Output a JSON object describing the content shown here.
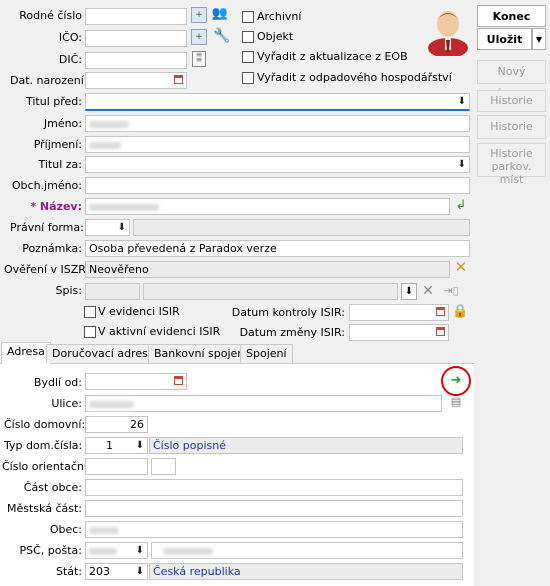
{
  "buttons": {
    "konec": "Konec",
    "ulozit": "Uložit",
    "ulozit_arrow": "▼",
    "novy_zaznam": "Nový záznam",
    "historie": "Historie",
    "historie_lozek": "Historie lůžek",
    "historie_parkov": "Historie parkov. míst"
  },
  "labels": {
    "rodne_cislo": "Rodné číslo",
    "ico": "IČO:",
    "dic": "DIČ:",
    "dat_narozeni": "Dat. narození:",
    "titul_pred": "Titul před:",
    "jmeno": "Jméno:",
    "prijmeni": "Příjmení:",
    "titul_za": "Titul za:",
    "obch_jmeno": "Obch.jméno:",
    "nazev": "* Název:",
    "pravni_forma": "Právní forma:",
    "poznamka": "Poznámka:",
    "overeni_iszr": "Ověření v ISZR:",
    "spis": "Spis:",
    "datum_kontroly_isir": "Datum kontroly ISIR:",
    "datum_zmeny_isir": "Datum změny ISIR:",
    "bydli_od": "Bydlí od:",
    "ulice": "Ulice:",
    "cislo_domovni": "Číslo domovní:",
    "typ_dom_cisla": "Typ dom.čísla:",
    "cislo_orientacni": "Číslo orientační:",
    "cast_obce": "Část obce:",
    "mestska_cast": "Městská část:",
    "obec": "Obec:",
    "psc_posta": "PSČ, pošta:",
    "stat": "Stát:"
  },
  "checkboxes": {
    "archivni": "Archivní",
    "objekt": "Objekt",
    "vyradit_eob": "Vyřadit z aktualizace z EOB",
    "vyradit_odpad": "Vyřadit z odpadového hospodářství",
    "v_evidenci_isir": "V evidenci ISIR",
    "v_aktivni_evidenci_isir": "V aktivní evidenci ISIR"
  },
  "values": {
    "poznamka": "Osoba převedená z Paradox verze",
    "overeni_iszr": "Neověřeno",
    "cislo_domovni": "26",
    "typ_dom_cisla_code": "1",
    "typ_dom_cisla_text": "Číslo popisné",
    "stat_code": "203",
    "stat_text": "Česká republika"
  },
  "tabs": [
    "Adresa",
    "Doručovací adresa",
    "Bankovní spojení",
    "Spojení"
  ],
  "colors": {
    "nazev_label": "#8a1f8a",
    "link_text": "#1a2fb4",
    "focus_underline": "#1e6fd9",
    "highlight_circle": "#e00000"
  },
  "icons": {
    "dropdown": "⬇",
    "go_arrow": "➜"
  }
}
